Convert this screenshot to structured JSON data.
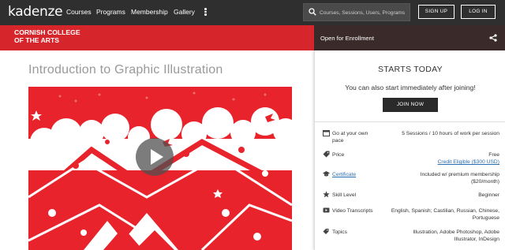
{
  "topnav": {
    "logo": "kadenze",
    "items": [
      "Courses",
      "Programs",
      "Membership",
      "Gallery"
    ],
    "search_placeholder": "Courses, Sessions, Users, Programs",
    "signup_label": "SIGN UP",
    "login_label": "LOG IN"
  },
  "banner": {
    "school_line1": "CORNISH COLLEGE",
    "school_line2": "OF THE ARTS",
    "enrollment_status": "Open for Enrollment"
  },
  "course": {
    "title": "Introduction to Graphic Illustration"
  },
  "card": {
    "starts": "STARTS TODAY",
    "subtitle": "You can also start immediately after joining!",
    "join_label": "JOIN NOW",
    "details": [
      {
        "icon": "calendar-icon",
        "label_line1": "Go at your own",
        "label_line2": "pace",
        "value_line1": "5 Sessions / 10 hours of work per session",
        "value_line2": ""
      },
      {
        "icon": "tag-icon",
        "label_line1": "Price",
        "label_line2": "",
        "value_line1": "Free",
        "value_line2": "Credit Eligible ($300 USD)"
      },
      {
        "icon": "graduation-cap-icon",
        "label_line1": "Certificate",
        "label_line2": "",
        "value_line1": "Included w/ premium membership",
        "value_line2": "($20/month)"
      },
      {
        "icon": "star-icon",
        "label_line1": "Skill Level",
        "label_line2": "",
        "value_line1": "Beginner",
        "value_line2": ""
      },
      {
        "icon": "video-icon",
        "label_line1": "Video Transcripts",
        "label_line2": "",
        "value_line1": "English, Spanish; Castilian, Russian, Chinese,",
        "value_line2": "Portuguese"
      },
      {
        "icon": "tags-icon",
        "label_line1": "Topics",
        "label_line2": "",
        "value_line1": "Illustration, Adobe Photoshop, Adobe",
        "value_line2": "Illustrator, InDesign"
      }
    ]
  },
  "colors": {
    "brand_red": "#d7252c",
    "nav_dark": "#2f2f2f",
    "link_blue": "#2a6fb0"
  }
}
